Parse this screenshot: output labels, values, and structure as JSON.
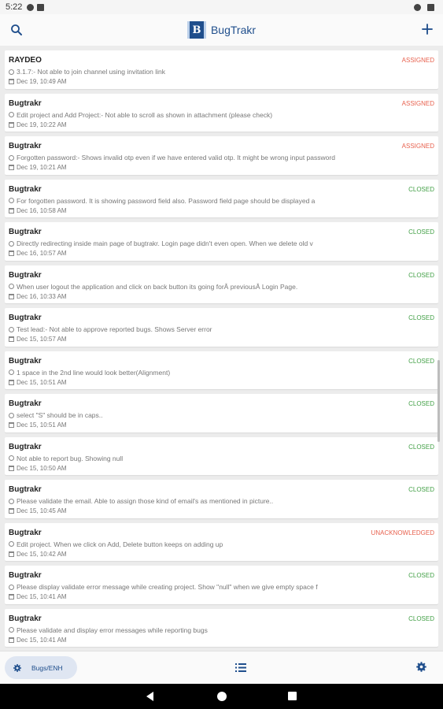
{
  "status_bar": {
    "time": "5:22"
  },
  "app_bar": {
    "title": "BugTrakr",
    "logo_letter": "B"
  },
  "colors": {
    "brand": "#1f4e8c",
    "assigned": "#e8624f",
    "closed": "#43a047",
    "unacknowledged": "#e8624f"
  },
  "bugs": [
    {
      "project": "RAYDEO",
      "status": "ASSIGNED",
      "status_type": "assigned",
      "description": "3.1.7:- Not able to join channel using invitation link",
      "date": "Dec 19, 10:49 AM"
    },
    {
      "project": "Bugtrakr",
      "status": "ASSIGNED",
      "status_type": "assigned",
      "description": "Edit project and Add Project:- Not able to scroll as shown in attachment (please check)",
      "date": "Dec 19, 10:22 AM"
    },
    {
      "project": "Bugtrakr",
      "status": "ASSIGNED",
      "status_type": "assigned",
      "description": "Forgotten password:- Shows invalid otp even if we have entered valid otp. It might be wrong input password",
      "date": "Dec 19, 10:21 AM"
    },
    {
      "project": "Bugtrakr",
      "status": "CLOSED",
      "status_type": "closed",
      "description": "For forgotten password. It is showing password field also. Password field page should be displayed a",
      "date": "Dec 16, 10:58 AM"
    },
    {
      "project": "Bugtrakr",
      "status": "CLOSED",
      "status_type": "closed",
      "description": "Directly redirecting inside main page of bugtrakr. Login page didn't even open. When we delete old v",
      "date": "Dec 16, 10:57 AM"
    },
    {
      "project": "Bugtrakr",
      "status": "CLOSED",
      "status_type": "closed",
      "description": "When user logout the application and click on back button its going forÂ previousÂ Login Page.",
      "date": "Dec 16, 10:33 AM"
    },
    {
      "project": "Bugtrakr",
      "status": "CLOSED",
      "status_type": "closed",
      "description": "Test lead:- Not able to approve reported bugs. Shows Server error",
      "date": "Dec 15, 10:57 AM"
    },
    {
      "project": "Bugtrakr",
      "status": "CLOSED",
      "status_type": "closed",
      "description": "1 space in the 2nd line would look better(Alignment)",
      "date": "Dec 15, 10:51 AM"
    },
    {
      "project": "Bugtrakr",
      "status": "CLOSED",
      "status_type": "closed",
      "description": "select \"S\" should be in caps..",
      "date": "Dec 15, 10:51 AM"
    },
    {
      "project": "Bugtrakr",
      "status": "CLOSED",
      "status_type": "closed",
      "description": "Not able to report bug. Showing null",
      "date": "Dec 15, 10:50 AM"
    },
    {
      "project": "Bugtrakr",
      "status": "CLOSED",
      "status_type": "closed",
      "description": "Please validate the email. Able to assign those kind of email's as mentioned in picture..",
      "date": "Dec 15, 10:45 AM"
    },
    {
      "project": "Bugtrakr",
      "status": "UNACKNOWLEDGED",
      "status_type": "unack",
      "description": "Edit project. When we click on Add, Delete button keeps on adding up",
      "date": "Dec 15, 10:42 AM"
    },
    {
      "project": "Bugtrakr",
      "status": "CLOSED",
      "status_type": "closed",
      "description": "Please display validate error message while creating project. Show \"null\" when we give empty space f",
      "date": "Dec 15, 10:41 AM"
    },
    {
      "project": "Bugtrakr",
      "status": "CLOSED",
      "status_type": "closed",
      "description": "Please validate and display error messages while reporting bugs",
      "date": "Dec 15, 10:41 AM"
    }
  ],
  "bottom_nav": {
    "bugs_label": "Bugs/ENH"
  }
}
